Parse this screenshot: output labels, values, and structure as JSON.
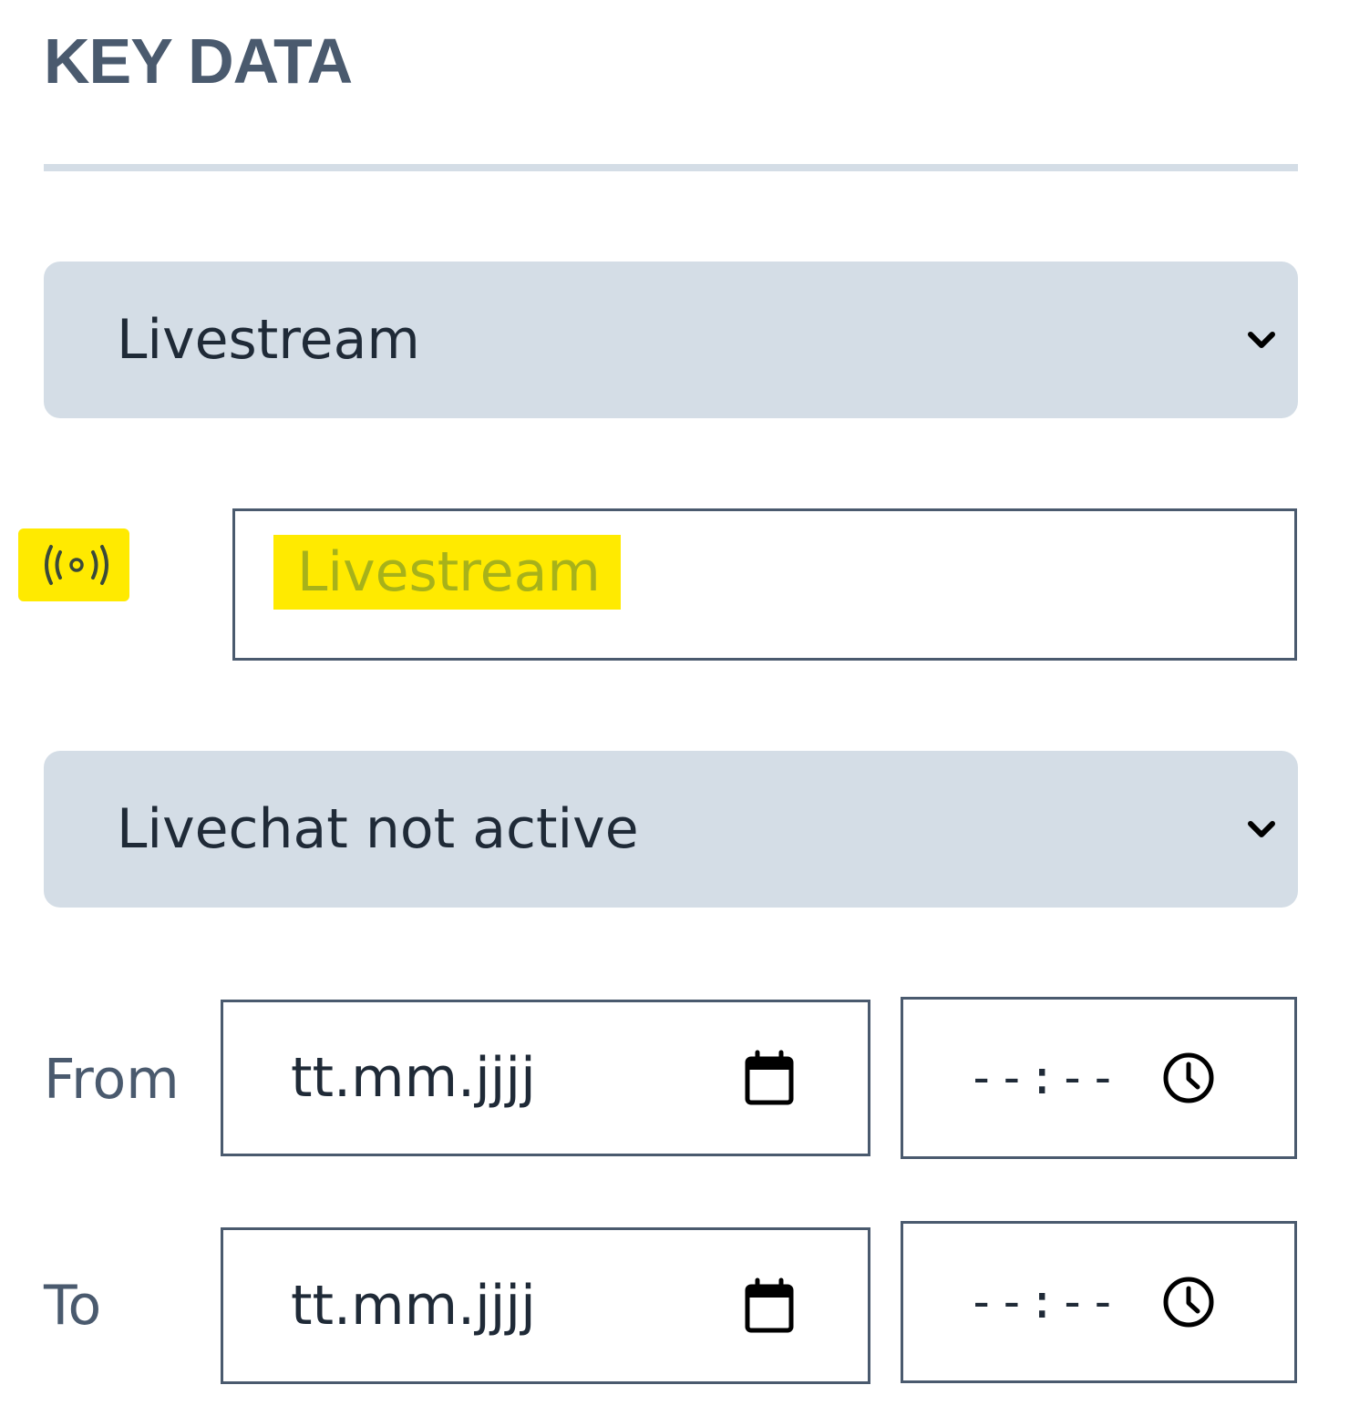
{
  "panel": {
    "title": "KEY DATA"
  },
  "stream_select": {
    "value": "Livestream",
    "icon": "chevron-down-icon"
  },
  "stream_title": {
    "icon": "broadcast-icon",
    "placeholder": "Livestream",
    "highlight_color": "#ffea00"
  },
  "chat_select": {
    "value": "Livechat not active",
    "icon": "chevron-down-icon"
  },
  "schedule": {
    "from": {
      "label": "From",
      "date_placeholder": "tt.mm.jjjj",
      "time_placeholder": "--:--"
    },
    "to": {
      "label": "To",
      "date_placeholder": "tt.mm.jjjj",
      "time_placeholder": "--:--"
    }
  },
  "colors": {
    "select_bg": "#d4dde6",
    "border": "#4a5a6e",
    "title": "#4a5a6e",
    "highlight": "#ffea00"
  }
}
